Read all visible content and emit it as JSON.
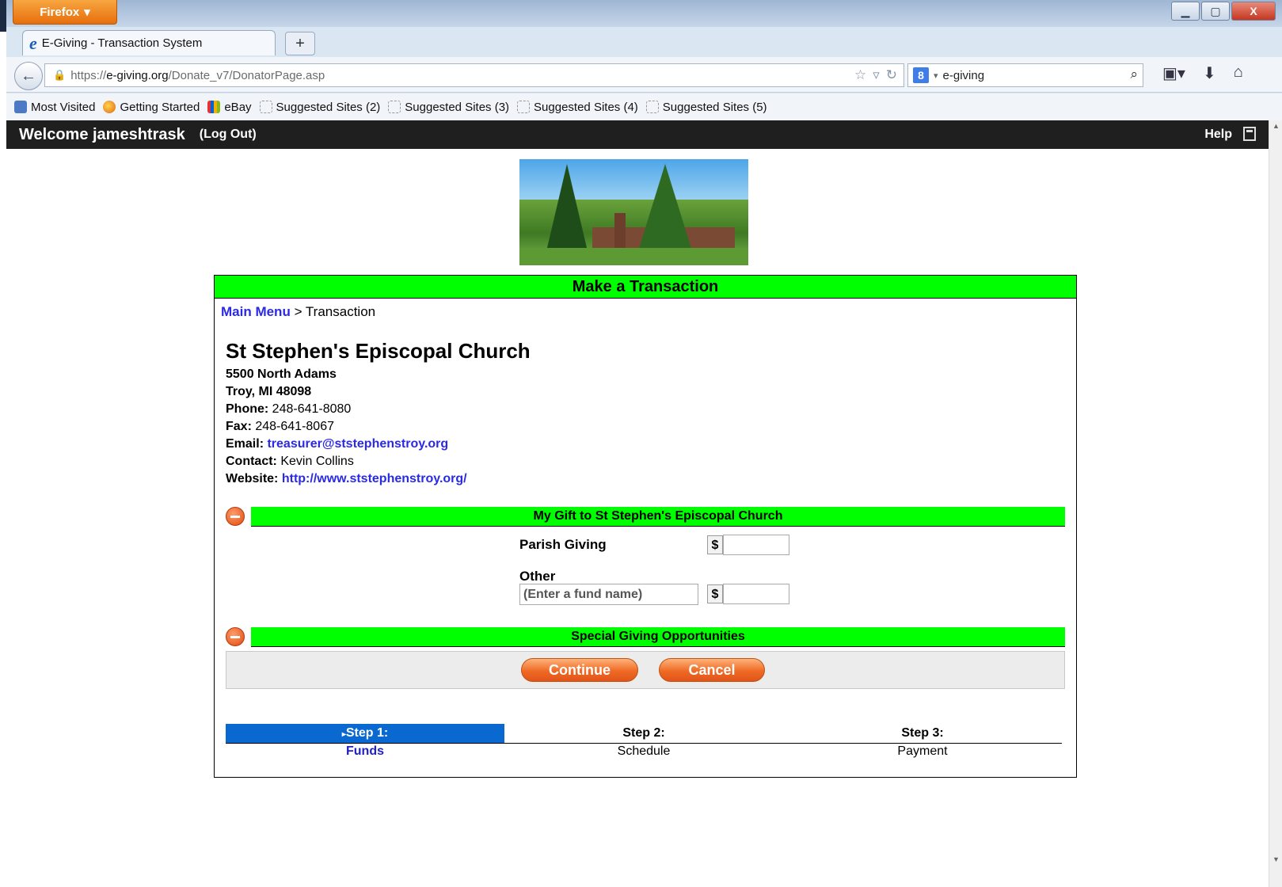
{
  "browser": {
    "menu_button": "Firefox",
    "tab_title": "E-Giving - Transaction System",
    "new_tab": "+",
    "url_prefix": "https://",
    "url_domain": "e-giving.org",
    "url_path": "/Donate_v7/DonatorPage.asp",
    "search_value": "e-giving",
    "bookmarks": [
      {
        "label": "Most Visited",
        "icon": "most-visited-icon"
      },
      {
        "label": "Getting Started",
        "icon": "firefox-icon"
      },
      {
        "label": "eBay",
        "icon": "ebay-icon"
      },
      {
        "label": "Suggested Sites (2)",
        "icon": "suggested-sites-icon"
      },
      {
        "label": "Suggested Sites (3)",
        "icon": "suggested-sites-icon"
      },
      {
        "label": "Suggested Sites (4)",
        "icon": "suggested-sites-icon"
      },
      {
        "label": "Suggested Sites (5)",
        "icon": "suggested-sites-icon"
      }
    ]
  },
  "header": {
    "welcome": "Welcome jameshtrask",
    "logout": "(Log Out)",
    "help": "Help"
  },
  "panel": {
    "title": "Make a Transaction",
    "breadcrumb_link": "Main Menu",
    "breadcrumb_current": "> Transaction"
  },
  "org": {
    "name": "St Stephen's Episcopal Church",
    "address1": "5500 North Adams",
    "address2": "Troy, MI 48098",
    "phone_label": "Phone:",
    "phone": "248-641-8080",
    "fax_label": "Fax:",
    "fax": "248-641-8067",
    "email_label": "Email:",
    "email": "treasurer@ststephenstroy.org",
    "contact_label": "Contact:",
    "contact": "Kevin Collins",
    "website_label": "Website:",
    "website": "http://www.ststephenstroy.org/"
  },
  "gift_section": {
    "title": "My Gift to St Stephen's Episcopal Church",
    "parish_label": "Parish Giving",
    "other_label": "Other",
    "fund_placeholder": "(Enter a fund name)",
    "currency": "$"
  },
  "special_section": {
    "title": "Special Giving Opportunities"
  },
  "buttons": {
    "continue": "Continue",
    "cancel": "Cancel"
  },
  "steps": [
    {
      "label": "Step 1:",
      "sub": "Funds",
      "active": true
    },
    {
      "label": "Step 2:",
      "sub": "Schedule",
      "active": false
    },
    {
      "label": "Step 3:",
      "sub": "Payment",
      "active": false
    }
  ],
  "colors": {
    "section_green": "#00ff00",
    "link_blue": "#2a2ae6",
    "active_step": "#0a68d1",
    "button_orange": "#ee6a25"
  }
}
